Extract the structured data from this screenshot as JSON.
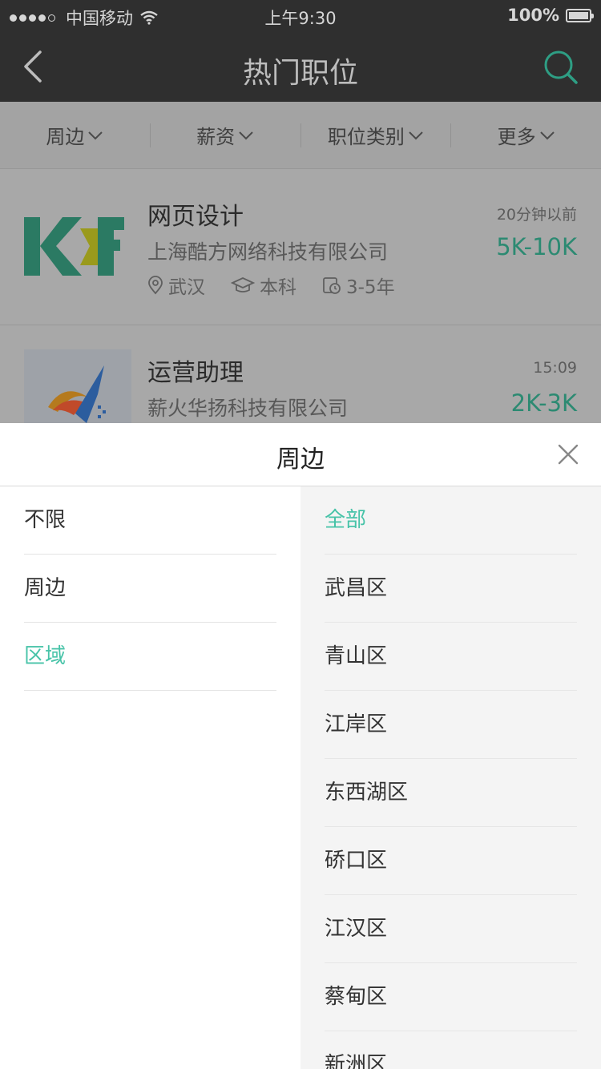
{
  "status_bar": {
    "carrier": "中国移动",
    "time": "上午9:30",
    "battery": "100%"
  },
  "nav": {
    "title": "热门职位",
    "back_icon": "chevron-left-icon",
    "search_icon": "search-icon"
  },
  "filters": [
    {
      "label": "周边"
    },
    {
      "label": "薪资"
    },
    {
      "label": "职位类别"
    },
    {
      "label": "更多"
    }
  ],
  "jobs": [
    {
      "title": "网页设计",
      "company": "上海酷方网络科技有限公司",
      "location": "武汉",
      "education": "本科",
      "experience": "3-5年",
      "time": "20分钟以前",
      "salary": "5K-10K"
    },
    {
      "title": "运营助理",
      "company": "薪火华扬科技有限公司",
      "time": "15:09",
      "salary": "2K-3K"
    }
  ],
  "sheet": {
    "title": "周边",
    "left_items": [
      {
        "label": "不限",
        "active": false
      },
      {
        "label": "周边",
        "active": false
      },
      {
        "label": "区域",
        "active": true
      }
    ],
    "right_items": [
      {
        "label": "全部",
        "active": true
      },
      {
        "label": "武昌区",
        "active": false
      },
      {
        "label": "青山区",
        "active": false
      },
      {
        "label": "江岸区",
        "active": false
      },
      {
        "label": "东西湖区",
        "active": false
      },
      {
        "label": "硚口区",
        "active": false
      },
      {
        "label": "江汉区",
        "active": false
      },
      {
        "label": "蔡甸区",
        "active": false
      },
      {
        "label": "新洲区",
        "active": false
      }
    ]
  },
  "colors": {
    "accent": "#47c3a8",
    "header_bg": "#2f2f2f",
    "salary": "#2c8a72"
  }
}
